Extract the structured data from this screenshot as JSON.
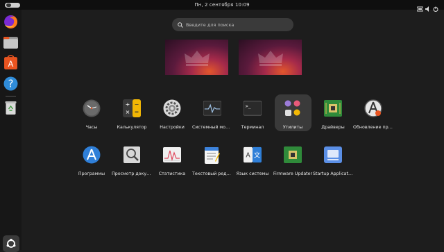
{
  "topbar": {
    "clock": "Пн, 2 сентября  10:09"
  },
  "dock": {
    "items": [
      {
        "name": "firefox",
        "icon": "firefox-icon"
      },
      {
        "name": "files",
        "icon": "files-icon"
      },
      {
        "name": "app-center",
        "icon": "app-center-icon"
      },
      {
        "name": "help",
        "icon": "help-icon"
      },
      {
        "name": "trash",
        "icon": "trash-icon"
      }
    ],
    "show_apps_icon": "ubuntu-show-apps-icon"
  },
  "search": {
    "placeholder": "Введите для поиска"
  },
  "apps": [
    {
      "label": "Часы",
      "icon": "clock-icon"
    },
    {
      "label": "Калькулятор",
      "icon": "calculator-icon"
    },
    {
      "label": "Настройки",
      "icon": "settings-icon"
    },
    {
      "label": "Системный монитор",
      "icon": "system-monitor-icon"
    },
    {
      "label": "Терминал",
      "icon": "terminal-icon"
    },
    {
      "label": "Утилиты",
      "icon": "folder-utilities-icon"
    },
    {
      "label": "Драйверы",
      "icon": "drivers-icon"
    },
    {
      "label": "Обновление приложений",
      "icon": "software-updater-icon"
    },
    {
      "label": "Программы",
      "icon": "software-properties-icon"
    },
    {
      "label": "Просмотр документов",
      "icon": "document-viewer-icon"
    },
    {
      "label": "Статистика",
      "icon": "power-statistics-icon"
    },
    {
      "label": "Текстовый редактор",
      "icon": "text-editor-icon"
    },
    {
      "label": "Язык системы",
      "icon": "language-support-icon"
    },
    {
      "label": "Firmware Updater",
      "icon": "firmware-updater-icon"
    },
    {
      "label": "Startup Applications",
      "icon": "startup-applications-icon"
    }
  ],
  "colors": {
    "background": "#1d1d1d",
    "topbar": "#0f0f0f",
    "dock": "#171717",
    "accent": "#e95420"
  }
}
